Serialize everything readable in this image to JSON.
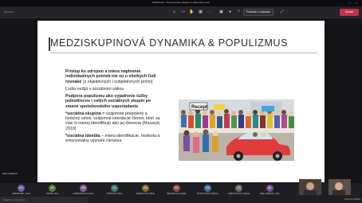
{
  "window": {
    "title": "Whiteboard - Dnesomodis poliadov ie (alternative text)"
  },
  "toolbar": {
    "timer": "01:05:47",
    "request_label": "Požiadať o ovládanie",
    "leave_label": "Opustiť"
  },
  "slide": {
    "title": "MEDZISKUPINOVÁ DYNAMIKA & POPULIZMUS",
    "p1_bold": "Prístup ku zdrojom a miera naplnenia individuálnych potrieb nie sú u všetkých ľudí rovnaké",
    "p1_rest": " (z objektívnych i subjektívnych príčin)",
    "p2": "Ľudia nežijú v sociálnom vákuu",
    "p3": "Podpora populizmu ako vyjadrenie túžby jednotlivcov i celých sociálnych skupín po zmene spoločenského usporiadania",
    "p4_bold": "*sociálna skupina",
    "p4_rest": " = vzájomne prepojený a funkčný celok, vzájomné interakcie členov, ktorí sa viac či menej identifikujú ako jej členovia (Masaryk, 2010)",
    "p5_bold": "*sociálna identita",
    "p5_rest": " – miera identifikácie, hodnota a emocionálny význam členstva",
    "illustration_caption": "Recept"
  },
  "presenter": {
    "name": "Mila LAFERCK"
  },
  "participants": [
    {
      "initials": "GG",
      "name": "GREGO MR., Hana",
      "color": "#6264a7"
    },
    {
      "initials": "JR",
      "name": "JURČE, Aleš",
      "color": "#5b7d3c"
    },
    {
      "initials": "HR",
      "name": "HORNÁČKOVÁ, Rene",
      "color": "#8a5a9c"
    },
    {
      "initials": "LD",
      "name": "LIPIČOVÁ, Dana",
      "color": "#3c7d7a"
    },
    {
      "initials": "ZM",
      "name": "ŽIGRAYOVÁ, Mária",
      "color": "#8c6a2c"
    },
    {
      "initials": "RK",
      "name": "ŘEHÁKOVÁ, Natália",
      "color": "#a04a4a"
    },
    {
      "initials": "RB",
      "name": "RUTKOVSKÁ, Barbora",
      "color": "#4a6aa0"
    },
    {
      "initials": "GZ",
      "name": "GAŽOVIČOVÁ, Zuzana",
      "color": "#6a6a6a"
    },
    {
      "initials": "ML",
      "name": "Mila LAFERCK, Jane",
      "color": "#7a4ea0"
    }
  ],
  "chat": {
    "placeholder": "Napíšte novú správu"
  },
  "clock": "14:10 4.11.2021",
  "colors": {
    "leave": "#c4314b",
    "toolbar": "#242429",
    "stage": "#141417",
    "slide": "#ffffff"
  }
}
